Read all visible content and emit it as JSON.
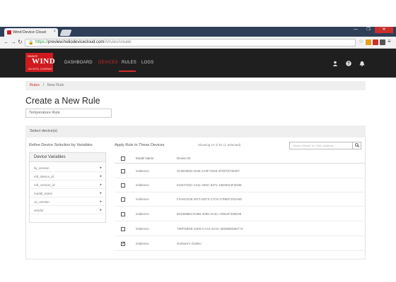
{
  "browser": {
    "tab_title": "Wind Device Cloud",
    "tab_close": "×",
    "url_scheme": "https://",
    "url_host": "preview.heliodevicecloud.com",
    "url_path": "/#/rules/create",
    "window_controls": [
      "—",
      "❐",
      "✕"
    ],
    "extension_colors": [
      "#e6a020",
      "#c9302c",
      "#555555"
    ]
  },
  "app": {
    "logo": {
      "top": "RAVAGE",
      "main": "WIND",
      "sub": "AN INTEL COMPANY"
    },
    "brand_color": "#cf1a1f",
    "nav": [
      "DASHBOARD",
      "DEVICES",
      "RULES",
      "LOGS"
    ],
    "active_nav": "RULES",
    "header_icons": [
      "user-icon",
      "help-icon",
      "bell-icon"
    ]
  },
  "breadcrumb": {
    "root": "Rules",
    "separator": "/",
    "current": "New Rule"
  },
  "page_title": "Create a New Rule",
  "rule_name_value": "Temperature Rule",
  "select_devices": {
    "heading": "Select device(s)",
    "refine_label": "Refine Device Selection by Variables",
    "apply_label": "Apply Rule to These Devices",
    "showing_text": "Showing 10 of 91 (1 Selected)",
    "search_placeholder": "Search Model, ID, MAC Address...",
    "variables": {
      "heading": "Device Variables",
      "items": [
        "fw_version",
        "mfr_device_id",
        "mfr_version_id",
        "model_name",
        "os_version",
        "vendor"
      ]
    },
    "table": {
      "columns": [
        "Model Name",
        "Device ID"
      ],
      "rows": [
        {
          "checked": false,
          "model": "intidevice",
          "device_id": "3C0E955D-2048-1A9F-9346-4F6679736397"
        },
        {
          "checked": false,
          "model": "intidevice",
          "device_id": "E46CF03C-A411-466C-9371-15E9D24F2D0E"
        },
        {
          "checked": false,
          "model": "intidevice",
          "device_id": "F2A6CD48-3971-EB73-17C9-1798DF203A5D"
        },
        {
          "checked": false,
          "model": "intidevice",
          "device_id": "B4D695B3-E36B-3095-3A4C-A9942F295E99"
        },
        {
          "checked": false,
          "model": "intidevice",
          "device_id": "790FDBD9-10D9-CA41-4A4C-4E55B6D98774"
        },
        {
          "checked": true,
          "model": "intidevice",
          "device_id": "Graham's Galileo"
        }
      ]
    }
  }
}
